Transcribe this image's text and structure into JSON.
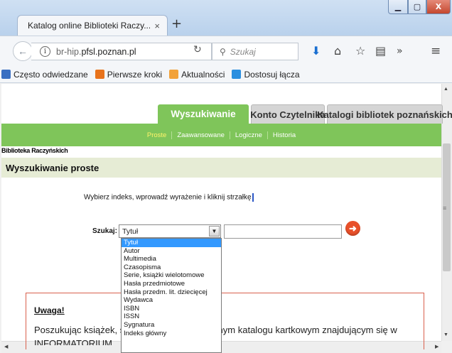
{
  "browser": {
    "tab_title": "Katalog online Biblioteki Raczy...",
    "tab_close": "×",
    "new_tab": "+",
    "window_buttons": {
      "minimize": "▁",
      "maximize": "▢",
      "close": "X"
    },
    "url_prefix": "br-hip.",
    "url_host": "pfsl.poznan.pl",
    "search_placeholder": "Szukaj",
    "bookmarks": [
      {
        "label": "Często odwiedzane",
        "color": "#3a6fc2"
      },
      {
        "label": "Pierwsze kroki",
        "color": "#e8731c"
      },
      {
        "label": "Aktualności",
        "color": "#f2a23a"
      },
      {
        "label": "Dostosuj łącza",
        "color": "#2b8fe0"
      }
    ]
  },
  "site": {
    "tabs": {
      "search": "Wyszukiwanie",
      "account": "Konto Czytelnika",
      "catalogs": "Katalogi bibliotek poznańskich"
    },
    "subnav": [
      "Proste",
      "Zaawansowane",
      "Logiczne",
      "Historia"
    ],
    "library_name": "Biblioteka Raczyńskich",
    "section_title": "Wyszukiwanie proste",
    "instruction": "Wybierz indeks, wprowadź wyrażenie i kliknij strzałkę",
    "search_label": "Szukaj:",
    "select_value": "Tytuł",
    "query_value": "",
    "dropdown_options": [
      "Tytuł",
      "Autor",
      "Multimedia",
      "Czasopisma",
      "Serie, książki wielotomowe",
      "Hasła przedmiotowe",
      "Hasła przedm. lit. dziecięcej",
      "Wydawca",
      "ISBN",
      "ISSN",
      "Sygnatura",
      "Indeks główny"
    ],
    "notice": {
      "title": "Uwaga!",
      "text_start": "Poszukując książek, s",
      "text_end": "yjnym katalogu kartkowym znajdującym się w",
      "text_line2": "INFORMATORIUM"
    },
    "colors": {
      "accent_green": "#7fc55a",
      "go_button": "#e8502a"
    }
  }
}
